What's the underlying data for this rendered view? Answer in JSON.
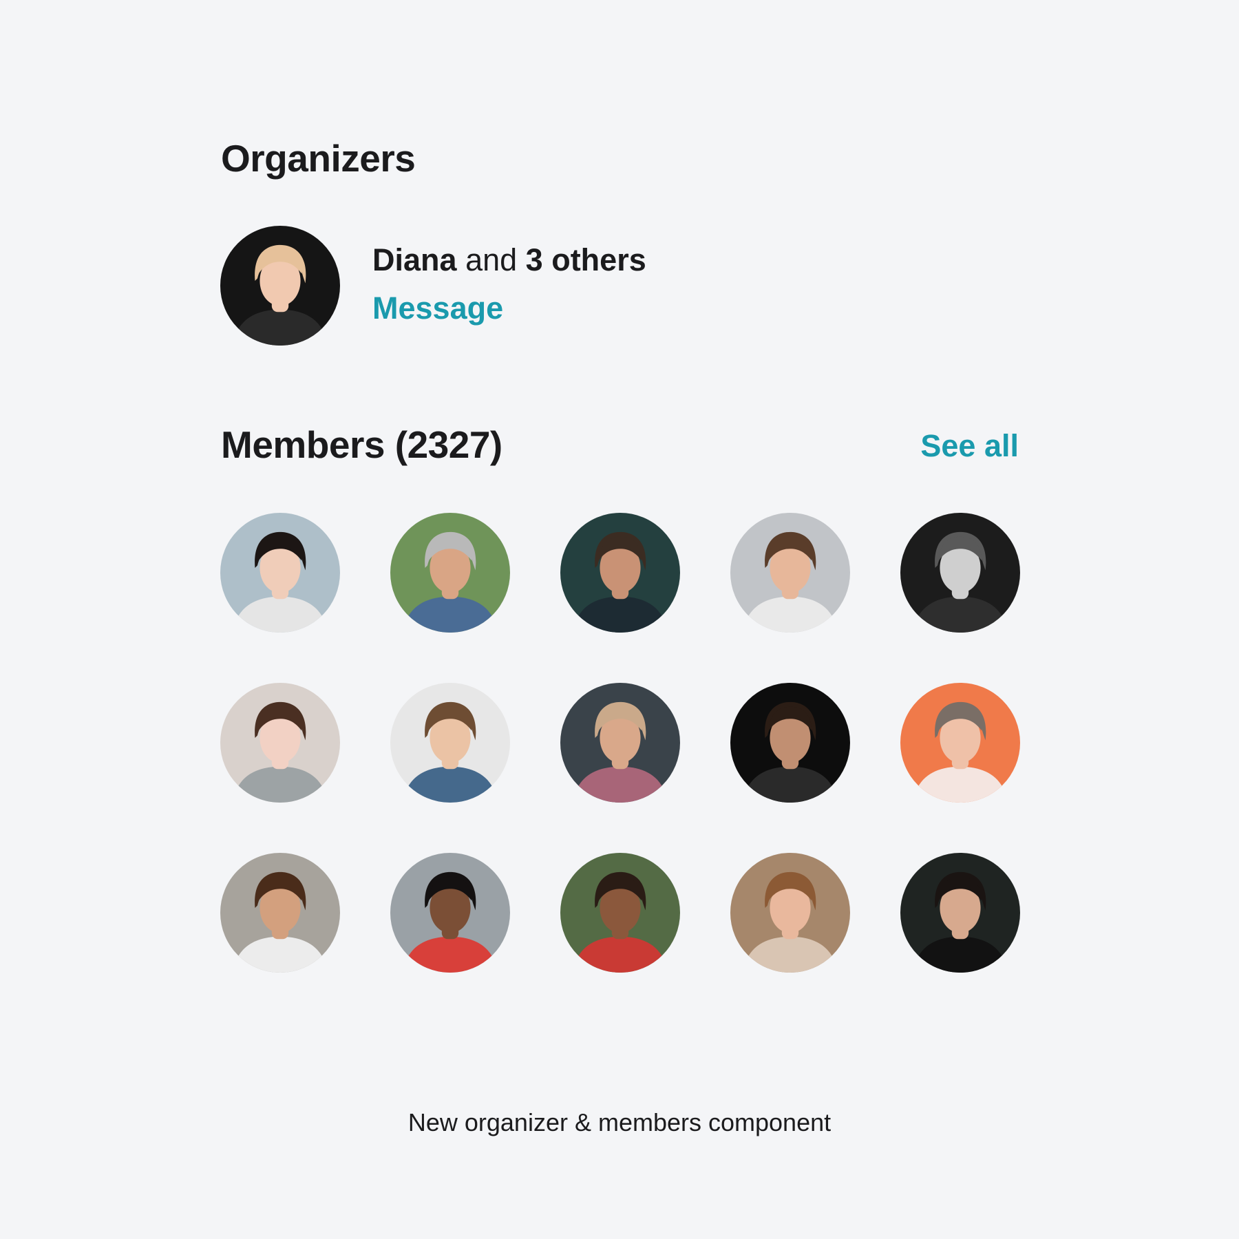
{
  "organizers": {
    "title": "Organizers",
    "lead_name": "Diana",
    "connector": "and",
    "others": "3 others",
    "message_label": "Message",
    "avatar": {
      "icon": "person-photo-icon",
      "bg": "#151515",
      "hair": "#e6c19a",
      "skin": "#f1c9b0",
      "shirt": "#2a2a2a"
    }
  },
  "members": {
    "title": "Members (2327)",
    "see_all_label": "See all",
    "avatars": [
      {
        "bg": "#aebfc9",
        "hair": "#1c1614",
        "skin": "#f0cdb9",
        "shirt": "#e5e5e5"
      },
      {
        "bg": "#6f9459",
        "hair": "#b9b9b9",
        "skin": "#d9a585",
        "shirt": "#4a6c95"
      },
      {
        "bg": "#24403f",
        "hair": "#3b2c22",
        "skin": "#c99275",
        "shirt": "#1d2b33"
      },
      {
        "bg": "#c1c4c8",
        "hair": "#5a3d2a",
        "skin": "#e7b79a",
        "shirt": "#e9e9e9"
      },
      {
        "bg": "#1c1c1c",
        "hair": "#595959",
        "skin": "#cfcfcf",
        "shirt": "#2e2e2e"
      },
      {
        "bg": "#d9d1cc",
        "hair": "#4a2f22",
        "skin": "#f2d1c4",
        "shirt": "#9da3a5"
      },
      {
        "bg": "#e7e7e7",
        "hair": "#6e4d33",
        "skin": "#ebc3a5",
        "shirt": "#45698c"
      },
      {
        "bg": "#3a434a",
        "hair": "#caa98a",
        "skin": "#d9a88a",
        "shirt": "#a86578"
      },
      {
        "bg": "#0d0d0d",
        "hair": "#2b1d15",
        "skin": "#c18f72",
        "shirt": "#2a2a2a"
      },
      {
        "bg": "#f07a4a",
        "hair": "#7a6e66",
        "skin": "#efc1a8",
        "shirt": "#f4e5e0"
      },
      {
        "bg": "#a7a39c",
        "hair": "#4a2c1a",
        "skin": "#d3a07e",
        "shirt": "#ececec"
      },
      {
        "bg": "#9aa1a6",
        "hair": "#141111",
        "skin": "#7b4f36",
        "shirt": "#d8403a"
      },
      {
        "bg": "#546b45",
        "hair": "#2a1c15",
        "skin": "#8b583c",
        "shirt": "#c93a34"
      },
      {
        "bg": "#a6876b",
        "hair": "#8c5a35",
        "skin": "#e9b89d",
        "shirt": "#d9c5b3"
      },
      {
        "bg": "#1f2422",
        "hair": "#1a1412",
        "skin": "#d7a98e",
        "shirt": "#121212"
      }
    ]
  },
  "caption": "New organizer & members component"
}
